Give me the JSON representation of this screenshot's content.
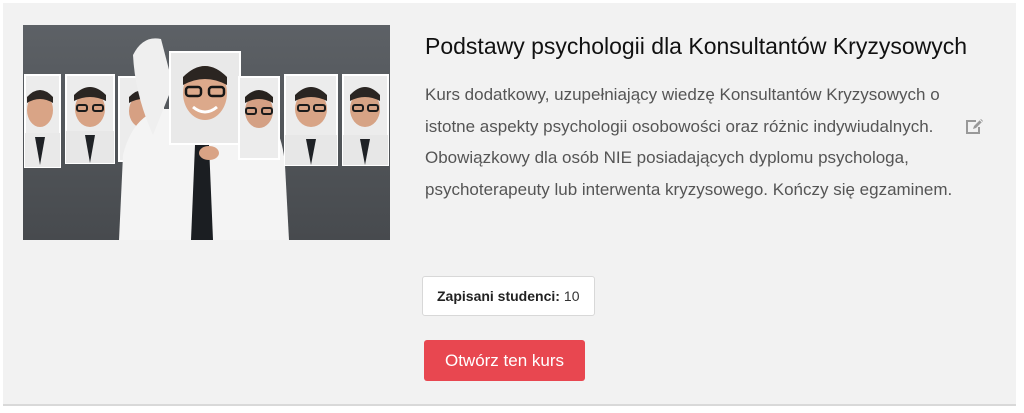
{
  "course": {
    "title": "Podstawy psychologii dla Konsultantów Kryzysowych",
    "description": "Kurs dodatkowy, uzupełniający wiedzę Konsultantów Kryzysowych o istotne aspekty psychologii osobowości oraz różnic indywiudalnych. Obowiązkowy dla osób NIE posiadających dyplomu psychologa, psychoterapeuty lub interwenta kryzysowego. Kończy się egzaminem.",
    "image_icon": "man-faces-masks-photo",
    "edit_icon": "edit-icon",
    "students_label": "Zapisani studenci:",
    "students_count": "10",
    "open_button_label": "Otwórz ten kurs"
  },
  "colors": {
    "card_bg": "#f2f2f2",
    "button_bg": "#e84750",
    "title_text": "#111111",
    "body_text": "#555555"
  }
}
